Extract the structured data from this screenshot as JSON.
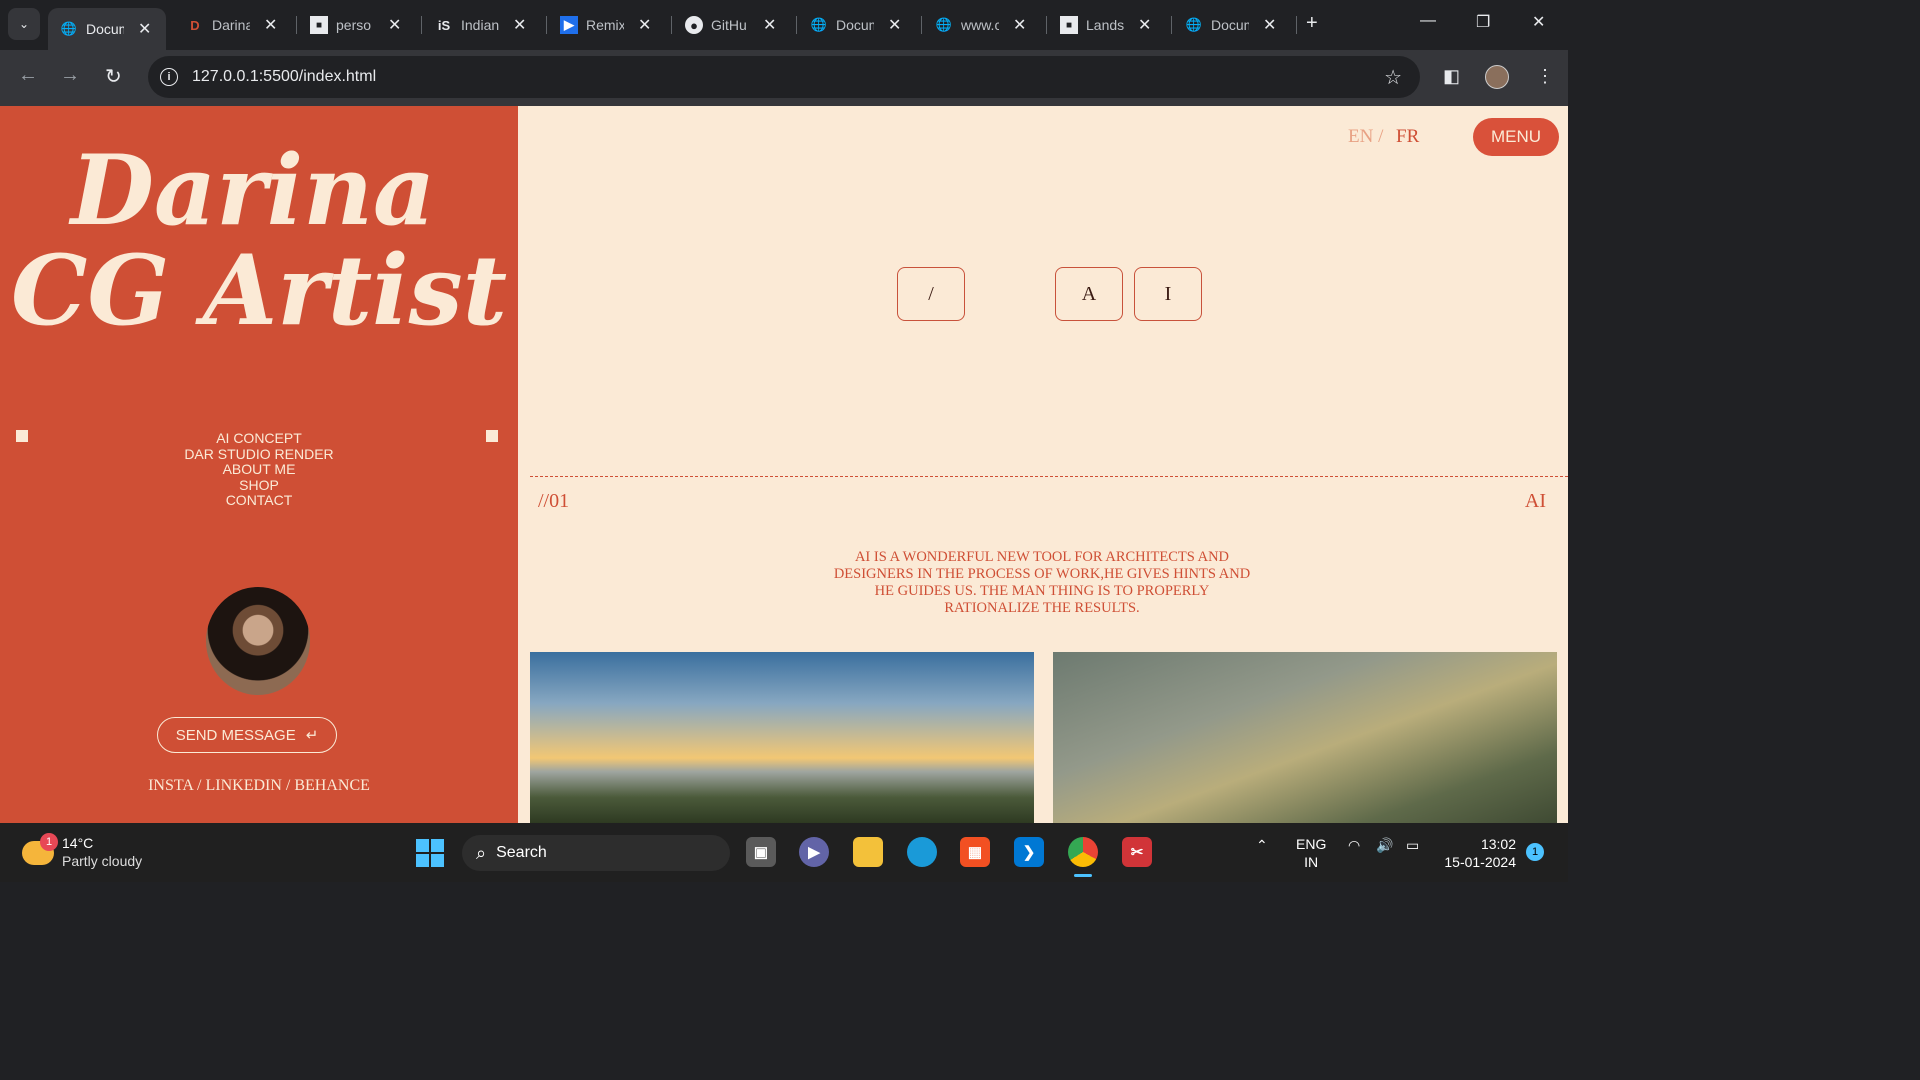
{
  "browser": {
    "tabs": [
      {
        "title": "Docum",
        "icon": "globe-icon",
        "active": true
      },
      {
        "title": "Darina",
        "icon": "darina-icon"
      },
      {
        "title": "perso",
        "icon": "unsplash-icon"
      },
      {
        "title": "Indian",
        "icon": "is-icon"
      },
      {
        "title": "Remix",
        "icon": "remix-icon"
      },
      {
        "title": "GitHu",
        "icon": "github-icon"
      },
      {
        "title": "Docum",
        "icon": "globe-icon"
      },
      {
        "title": "www.c",
        "icon": "globe-icon"
      },
      {
        "title": "Lands",
        "icon": "unsplash-icon"
      },
      {
        "title": "Docum",
        "icon": "globe-icon"
      }
    ],
    "url": "127.0.0.1:5500/index.html"
  },
  "site": {
    "hero_line1": "Darina",
    "hero_line2": "CG Artist",
    "nav": [
      "AI CONCEPT",
      "DAR STUDIO RENDER",
      "ABOUT ME",
      "SHOP",
      "CONTACT"
    ],
    "send_message": "SEND MESSAGE",
    "social": "INSTA / LINKEDIN / BEHANCE",
    "lang_en": "EN /",
    "lang_fr": "FR",
    "menu": "MENU",
    "boxes": [
      "/",
      "A",
      "I"
    ],
    "section_num": "//01",
    "section_tag": "AI",
    "description": "AI IS A WONDERFUL NEW TOOL FOR ARCHITECTS AND DESIGNERS IN THE PROCESS OF WORK,HE GIVES HINTS AND HE GUIDES US. THE MAN THING IS TO PROPERLY RATIONALIZE THE RESULTS.",
    "colors": {
      "accent": "#cf4f35",
      "cream": "#fbead6"
    }
  },
  "taskbar": {
    "temp": "14°C",
    "weather": "Partly cloudy",
    "weather_badge": "1",
    "search": "Search",
    "lang_line1": "ENG",
    "lang_line2": "IN",
    "time": "13:02",
    "date": "15-01-2024",
    "notifications": "1"
  }
}
